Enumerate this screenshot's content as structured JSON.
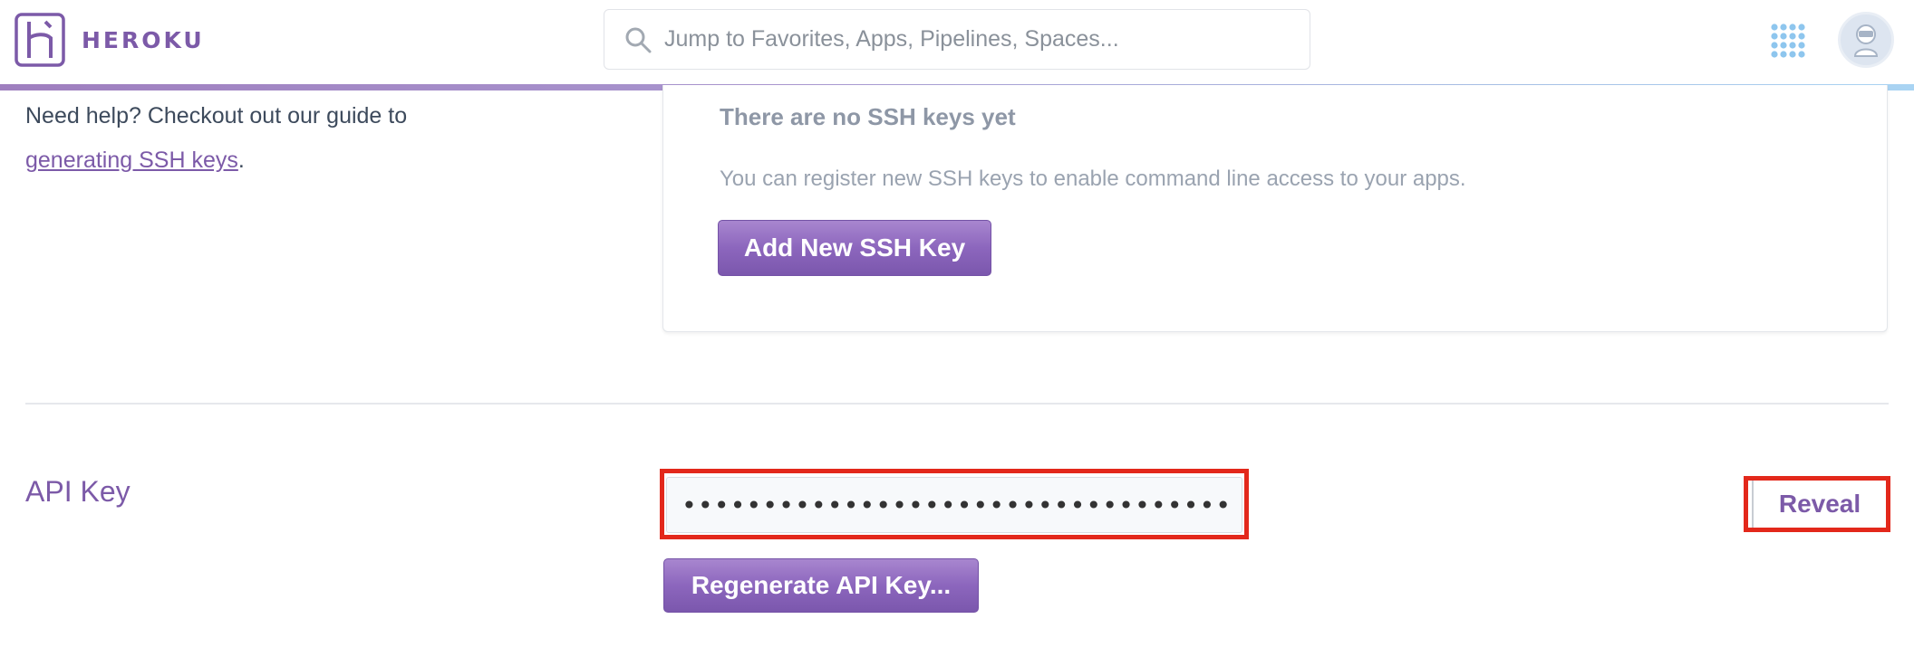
{
  "header": {
    "brand": "HEROKU",
    "search_placeholder": "Jump to Favorites, Apps, Pipelines, Spaces...",
    "icons": {
      "logo": "heroku-logo-icon",
      "search": "search-icon",
      "apps": "apps-grid-icon",
      "avatar": "user-avatar-icon"
    },
    "accent_color": "#7c5aa8"
  },
  "help": {
    "text": "Need help? Checkout out our guide to",
    "link": "generating SSH keys",
    "suffix": "."
  },
  "ssh": {
    "empty_title": "There are no SSH keys yet",
    "empty_desc": "You can register new SSH keys to enable command line access to your apps.",
    "add_button": "Add New SSH Key"
  },
  "api": {
    "label": "API Key",
    "masked_value": "••••••••••••••••••••••••••••••••••",
    "reveal_button": "Reveal",
    "regenerate_button": "Regenerate API Key..."
  },
  "highlight_color": "#e3281b"
}
